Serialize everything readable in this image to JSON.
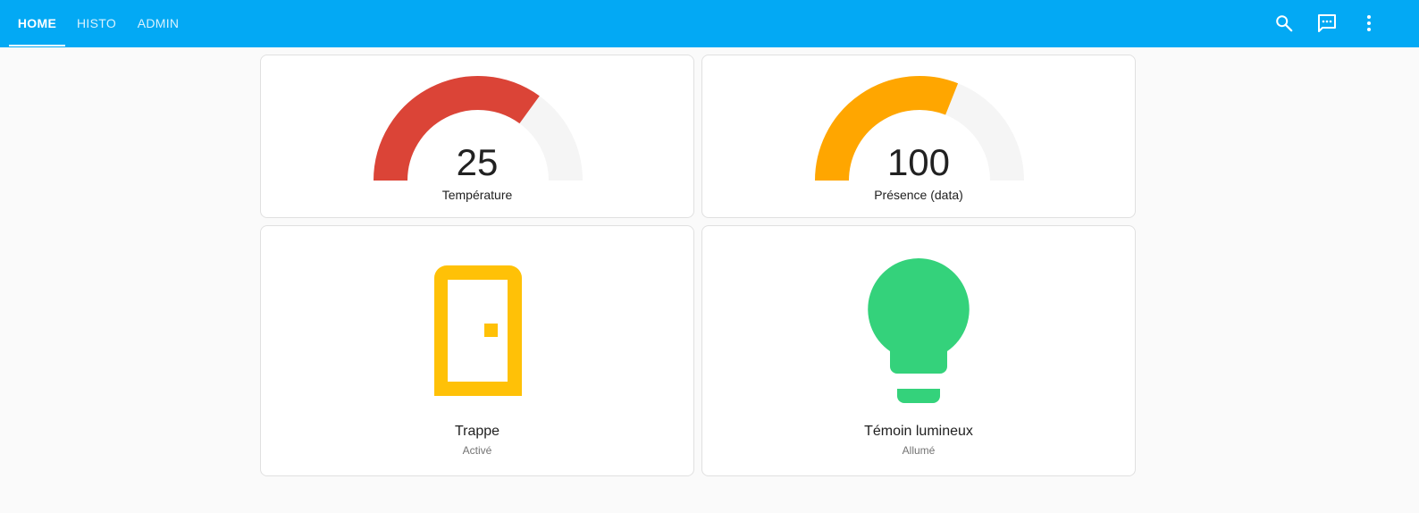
{
  "header": {
    "tabs": [
      {
        "label": "HOME",
        "active": true
      },
      {
        "label": "HISTO",
        "active": false
      },
      {
        "label": "ADMIN",
        "active": false
      }
    ],
    "tools": [
      "search-icon",
      "chat-icon",
      "more-vert-icon"
    ]
  },
  "colors": {
    "header_bg": "#03a9f4",
    "gauge_temperature": "#db4437",
    "gauge_presence": "#ffa600",
    "gauge_track": "#f5f5f5",
    "door_icon": "#ffc107",
    "bulb_icon": "#34d27b"
  },
  "cards": {
    "temperature": {
      "value": "25",
      "name": "Température",
      "fill_fraction": 0.7
    },
    "presence": {
      "value": "100",
      "name": "Présence (data)",
      "fill_fraction": 0.62
    },
    "trappe": {
      "name": "Trappe",
      "state": "Activé",
      "icon": "door-icon"
    },
    "temoin": {
      "name": "Témoin lumineux",
      "state": "Allumé",
      "icon": "lightbulb-icon"
    }
  }
}
